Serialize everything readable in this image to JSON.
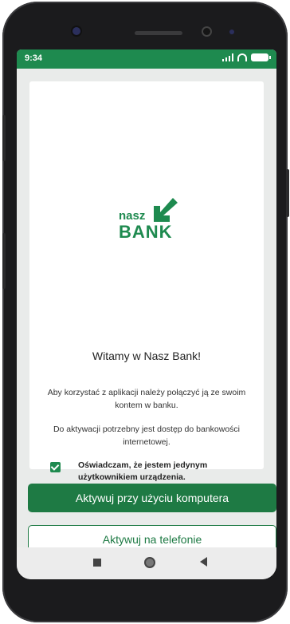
{
  "status_bar": {
    "time": "9:34"
  },
  "logo": {
    "line1": "nasz",
    "line2": "BANK",
    "brand_color": "#1e8a4f"
  },
  "welcome": {
    "title": "Witamy w Nasz Bank!",
    "para1": "Aby korzystać z aplikacji należy połączyć ją ze swoim kontem w banku.",
    "para2": "Do aktywacji potrzebny jest dostęp do bankowości internetowej.",
    "consent": "Oświadczam, że jestem jedynym użytkownikiem urządzenia.",
    "consent_checked": true
  },
  "actions": {
    "primary": "Aktywuj przy użyciu komputera",
    "secondary": "Aktywuj na telefonie"
  },
  "nav_icons": [
    "recents-icon",
    "home-icon",
    "back-icon"
  ]
}
